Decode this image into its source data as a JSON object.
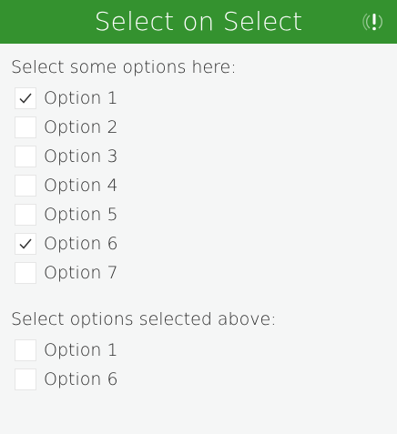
{
  "header": {
    "title": "Select on Select",
    "status_icon": "gps-warning-icon",
    "background_color": "#34922f"
  },
  "group1": {
    "label": "Select some options here:",
    "options": [
      {
        "label": "Option 1",
        "checked": true
      },
      {
        "label": "Option 2",
        "checked": false
      },
      {
        "label": "Option 3",
        "checked": false
      },
      {
        "label": "Option 4",
        "checked": false
      },
      {
        "label": "Option 5",
        "checked": false
      },
      {
        "label": "Option 6",
        "checked": true
      },
      {
        "label": "Option 7",
        "checked": false
      }
    ]
  },
  "group2": {
    "label": "Select options selected above:",
    "options": [
      {
        "label": "Option 1",
        "checked": false
      },
      {
        "label": "Option 6",
        "checked": false
      }
    ]
  }
}
